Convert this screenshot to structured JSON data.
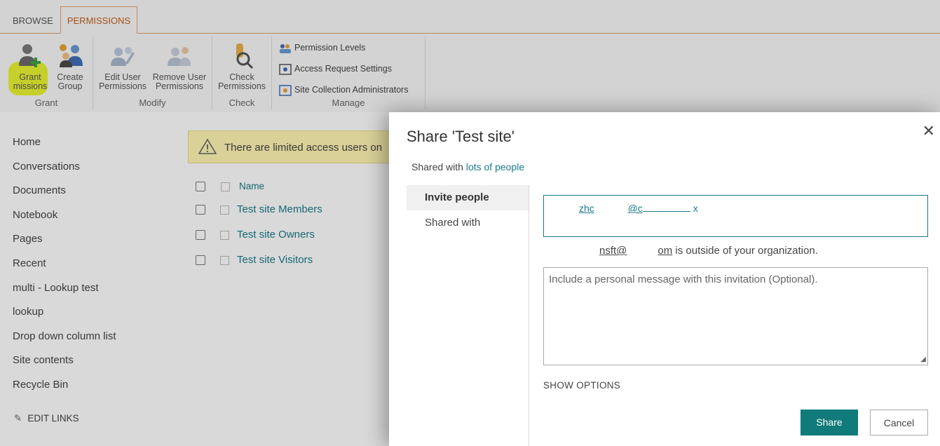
{
  "ribbon": {
    "tabs": [
      "BROWSE",
      "PERMISSIONS"
    ],
    "groups": {
      "grant": "Grant",
      "modify": "Modify",
      "check": "Check",
      "manage": "Manage"
    },
    "buttons": {
      "grant_permissions": "Grant\nmissions",
      "create_group": "Create\nGroup",
      "edit_user_permissions": "Edit User\nPermissions",
      "remove_user_permissions": "Remove User\nPermissions",
      "check_permissions": "Check\nPermissions"
    },
    "manage_items": [
      "Permission Levels",
      "Access Request Settings",
      "Site Collection Administrators"
    ]
  },
  "nav": {
    "items": [
      "Home",
      "Conversations",
      "Documents",
      "Notebook",
      "Pages",
      "Recent",
      "multi - Lookup test",
      "lookup",
      "Drop down column list",
      "Site contents",
      "Recycle Bin"
    ],
    "edit_links": "EDIT LINKS"
  },
  "notice": "There are limited access users on",
  "list": {
    "column_name": "Name",
    "rows": [
      "Test site Members",
      "Test site Owners",
      "Test site Visitors"
    ]
  },
  "dialog": {
    "title": "Share 'Test site'",
    "shared_with_prefix": "Shared with ",
    "shared_with_link": "lots of people",
    "tabs": [
      "Invite people",
      "Shared with"
    ],
    "invitee_part1": "zhc",
    "invitee_part2": "@c",
    "invitee_remove": "x",
    "outside_part1": "nsft@",
    "outside_part2": "om",
    "outside_suffix": " is outside of your organization.",
    "message_placeholder": "Include a personal message with this invitation (Optional).",
    "show_options": "SHOW OPTIONS",
    "share_label": "Share",
    "cancel_label": "Cancel"
  }
}
